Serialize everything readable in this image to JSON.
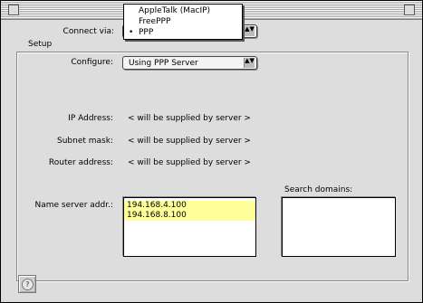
{
  "connect": {
    "label": "Connect via:",
    "options": [
      "AppleTalk (MacIP)",
      "FreePPP",
      "PPP"
    ],
    "selected_marker": "•",
    "arrows_glyph": "▲▼"
  },
  "setup": {
    "group_title": "Setup",
    "configure_label": "Configure:",
    "configure_value": "Using PPP Server",
    "arrows_glyph": "▲▼",
    "ip_label": "IP Address:",
    "ip_value": "< will be supplied by server >",
    "subnet_label": "Subnet mask:",
    "subnet_value": "< will be supplied by server >",
    "router_label": "Router address:",
    "router_value": "< will be supplied by server >",
    "name_server_label": "Name server addr.:",
    "name_servers": [
      "194.168.4.100",
      "194.168.8.100"
    ],
    "search_domains_label": "Search domains:"
  },
  "help": {
    "glyph": "?"
  },
  "colors": {
    "window_bg": "#dddddd",
    "list_highlight": "#ffff99"
  }
}
